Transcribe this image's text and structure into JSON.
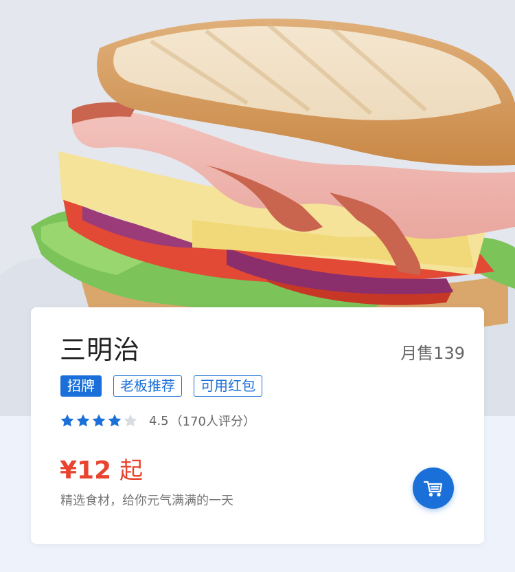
{
  "product": {
    "name": "三明治",
    "monthly_sales": "月售139",
    "tags": [
      "招牌",
      "老板推荐",
      "可用红包"
    ],
    "rating": {
      "score": "4.5",
      "count_text": "（170人评分）",
      "stars_filled": 4,
      "stars_total": 5
    },
    "price": "¥12",
    "price_suffix": "起",
    "description": "精选食材，给你元气满满的一天"
  },
  "icons": {
    "cart": "shopping-cart-icon",
    "star": "star-icon"
  },
  "colors": {
    "accent_blue": "#1a6fd8",
    "price_red": "#e8442f",
    "star_filled": "#1a6fd8",
    "star_empty": "#d9dde3"
  }
}
